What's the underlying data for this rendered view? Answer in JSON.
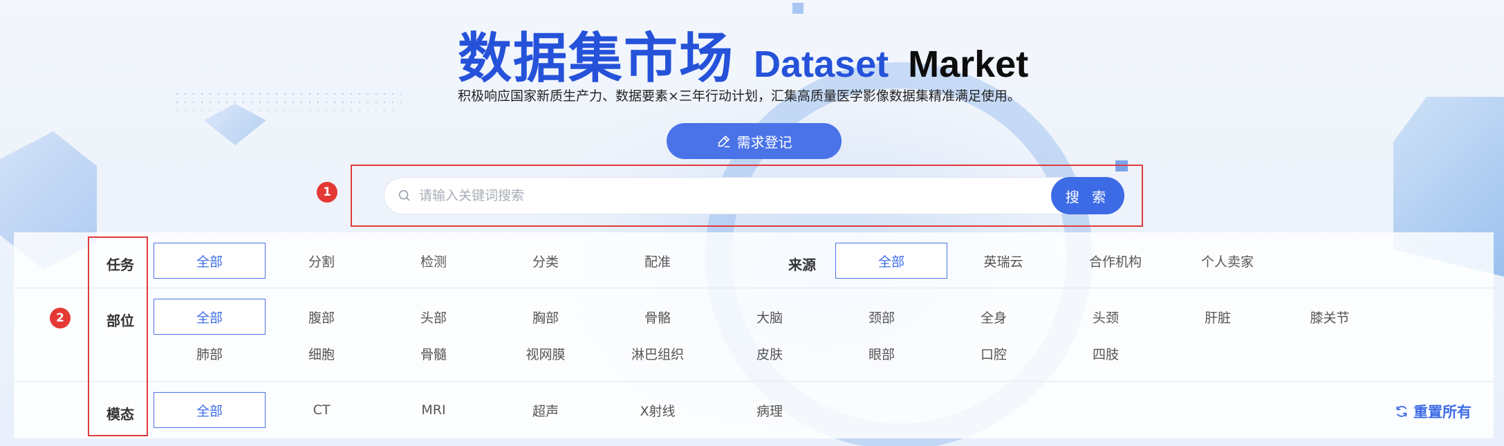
{
  "hero": {
    "title_cn": "数据集市场",
    "title_en_1": "Dataset",
    "title_en_2": "Market",
    "subtitle": "积极响应国家新质生产力、数据要素×三年行动计划，汇集高质量医学影像数据集精准满足使用。",
    "demand_button": "需求登记"
  },
  "annotations": {
    "badge1": "1",
    "badge2": "2"
  },
  "search": {
    "placeholder": "请输入关键词搜索",
    "value": "",
    "button": "搜 索"
  },
  "filters": {
    "task": {
      "label": "任务",
      "options": [
        "全部",
        "分割",
        "检测",
        "分类",
        "配准"
      ],
      "selected": "全部"
    },
    "source": {
      "label": "来源",
      "options": [
        "全部",
        "英瑞云",
        "合作机构",
        "个人卖家"
      ],
      "selected": "全部"
    },
    "part": {
      "label": "部位",
      "options_row1": [
        "全部",
        "腹部",
        "头部",
        "胸部",
        "骨骼",
        "大脑",
        "颈部",
        "全身",
        "头颈",
        "肝脏",
        "膝关节"
      ],
      "options_row2": [
        "肺部",
        "细胞",
        "骨髓",
        "视网膜",
        "淋巴组织",
        "皮肤",
        "眼部",
        "口腔",
        "四肢"
      ],
      "selected": "全部"
    },
    "modality": {
      "label": "模态",
      "options": [
        "全部",
        "CT",
        "MRI",
        "超声",
        "X射线",
        "病理"
      ],
      "selected": "全部"
    },
    "reset_label": "重置所有"
  },
  "colors": {
    "accent": "#3d6be5",
    "title_blue": "#2552d9",
    "annotation_red": "#e03a3a"
  }
}
